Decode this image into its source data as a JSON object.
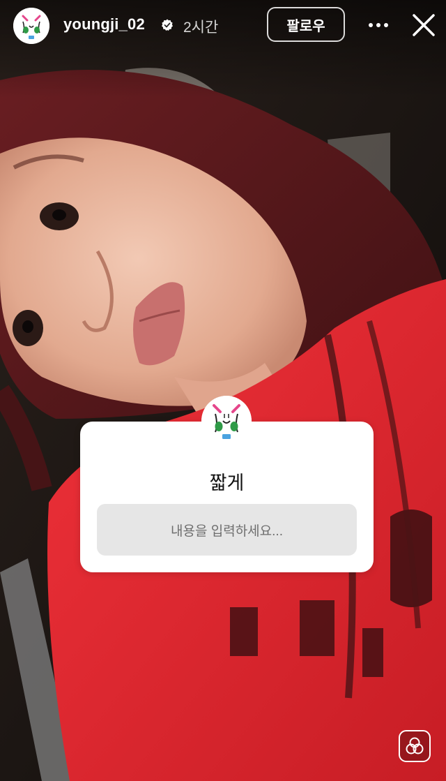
{
  "header": {
    "username": "youngji_02",
    "time_ago": "2시간",
    "follow_label": "팔로우",
    "more_icon": "more-horizontal-icon",
    "close_icon": "close-icon",
    "verified_icon": "verified-badge-icon"
  },
  "sticker": {
    "title": "짧게",
    "input_placeholder": "내용을 입력하세요..."
  },
  "effect_button": {
    "icon": "effects-icon"
  },
  "colors": {
    "shirt_red": "#e6262e",
    "hair": "#5a1a1c",
    "sticker_bg": "#ffffff",
    "input_bg": "#e6e6e6",
    "verified_blue": "#ffffff"
  }
}
